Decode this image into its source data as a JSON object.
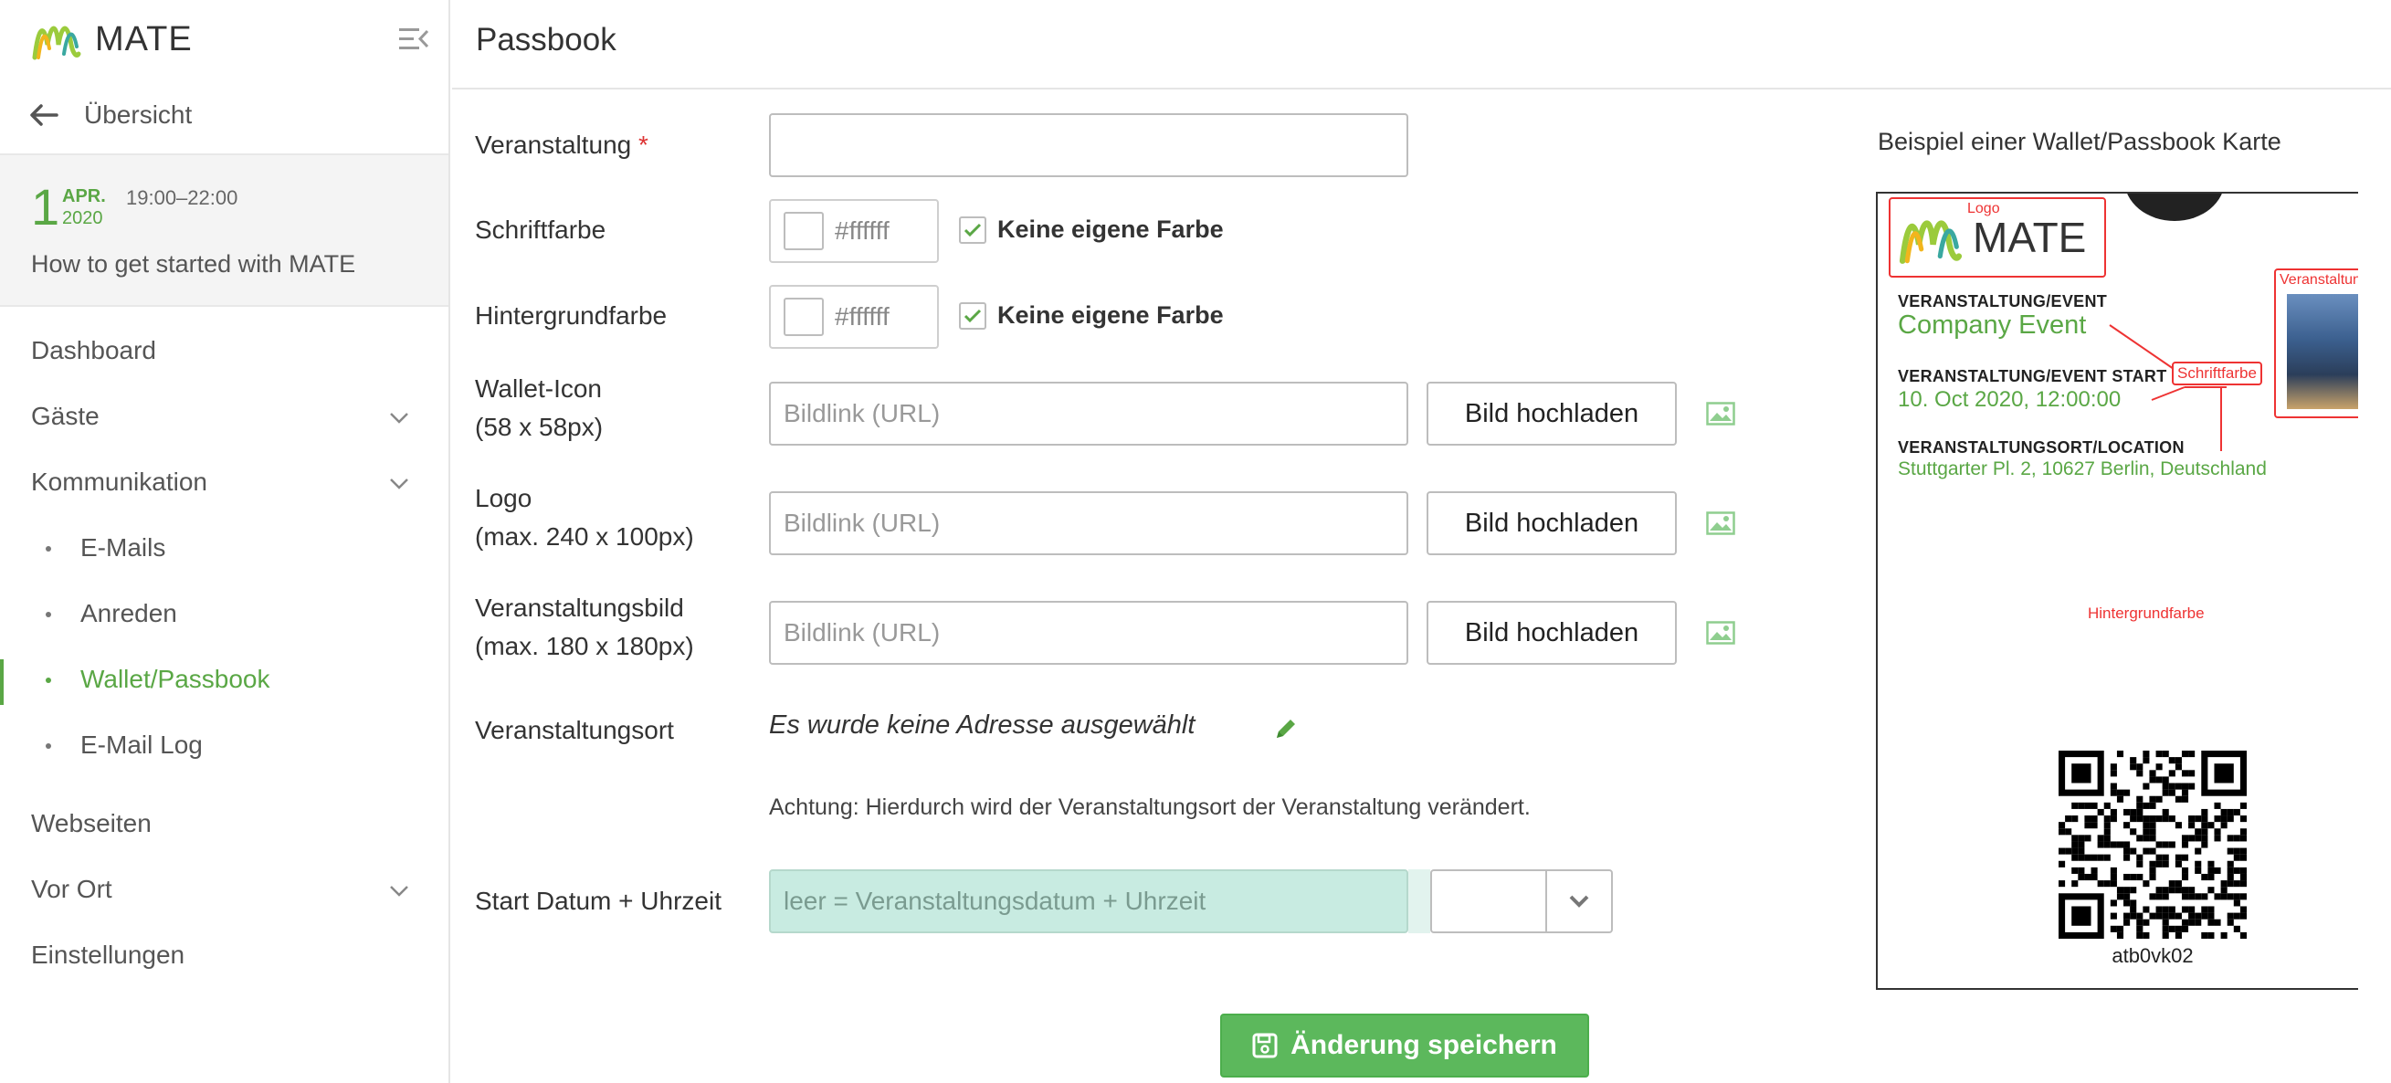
{
  "app": {
    "name": "MATE"
  },
  "sidebar": {
    "back_label": "Übersicht",
    "event": {
      "day": "1",
      "month": "APR.",
      "year": "2020",
      "time": "19:00–22:00",
      "title": "How to get started with MATE"
    },
    "nav": [
      {
        "label": "Dashboard"
      },
      {
        "label": "Gäste"
      },
      {
        "label": "Kommunikation"
      },
      {
        "label": "Webseiten"
      },
      {
        "label": "Vor Ort"
      },
      {
        "label": "Einstellungen"
      }
    ],
    "sub_items": [
      {
        "label": "E-Mails"
      },
      {
        "label": "Anreden"
      },
      {
        "label": "Wallet/Passbook",
        "active": true
      },
      {
        "label": "E-Mail Log"
      }
    ]
  },
  "header": {
    "title": "Passbook"
  },
  "form": {
    "event_label": "Veranstaltung",
    "required_mark": "*",
    "font_color_label": "Schriftfarbe",
    "font_color_value": "#ffffff",
    "bg_color_label": "Hintergrundfarbe",
    "bg_color_value": "#ffffff",
    "no_color_label": "Keine eigene Farbe",
    "wallet_icon_label_1": "Wallet-Icon",
    "wallet_icon_label_2": "(58 x 58px)",
    "logo_label_1": "Logo",
    "logo_label_2": "(max. 240 x 100px)",
    "event_image_label_1": "Veranstaltungsbild",
    "event_image_label_2": "(max. 180 x 180px)",
    "url_placeholder": "Bildlink (URL)",
    "upload_button": "Bild hochladen",
    "location_label": "Veranstaltungsort",
    "location_value": "Es wurde keine Adresse ausgewählt",
    "location_hint": "Achtung: Hierdurch wird der Veranstaltungsort der Veranstaltung verändert.",
    "start_label": "Start Datum + Uhrzeit",
    "start_placeholder": "leer = Veranstaltungsdatum + Uhrzeit",
    "save_button": "Änderung speichern"
  },
  "preview": {
    "title": "Beispiel einer Wallet/Passbook Karte",
    "logo_tag": "Logo",
    "logo_text": "MATE",
    "event_key": "VERANSTALTUNG/EVENT",
    "event_value": "Company Event",
    "start_key": "VERANSTALTUNG/EVENT START",
    "start_value": "10. Oct 2020, 12:00:00",
    "location_key": "VERANSTALTUNGSORT/LOCATION",
    "location_value": "Stuttgarter Pl. 2, 10627 Berlin, Deutschland",
    "image_tag": "Veranstaltungsbild",
    "font_color_tag": "Schriftfarbe",
    "bg_color_tag": "Hintergrundfarbe",
    "barcode_text": "atb0vk02"
  },
  "colors": {
    "accent": "#5aa745",
    "annotation": "#e33333",
    "save": "#5cb85c"
  }
}
